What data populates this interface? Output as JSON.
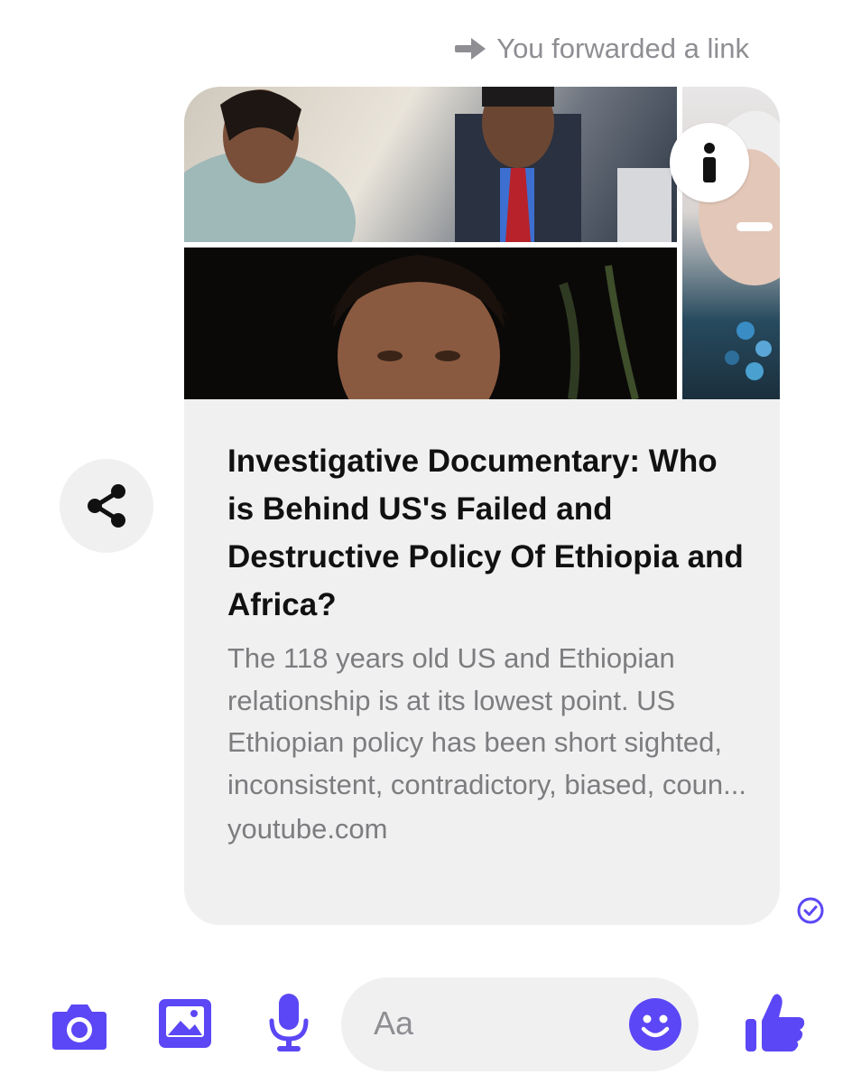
{
  "header": {
    "forward_text": "You forwarded a link",
    "forward_icon": "arrow-right-icon"
  },
  "link_card": {
    "title": "Investigative Documentary: Who is Behind US's Failed and Destructive Policy Of Ethiopia and Africa?",
    "description": "The 118 years old US and Ethiopian relationship is at its lowest point. US Ethiopian policy has been short sighted, inconsistent, contradictory, biased, coun...",
    "domain": "youtube.com",
    "info_icon": "info-icon"
  },
  "actions": {
    "share_icon": "share-icon",
    "seen_icon": "check-circle-icon"
  },
  "composer": {
    "placeholder": "Aa",
    "icons": [
      "camera-icon",
      "gallery-icon",
      "microphone-icon",
      "emoji-icon",
      "thumbs-up-icon"
    ]
  },
  "colors": {
    "accent": "#5B47F5",
    "bubble": "#F0F0F1",
    "muted_text": "#8E8E93"
  }
}
